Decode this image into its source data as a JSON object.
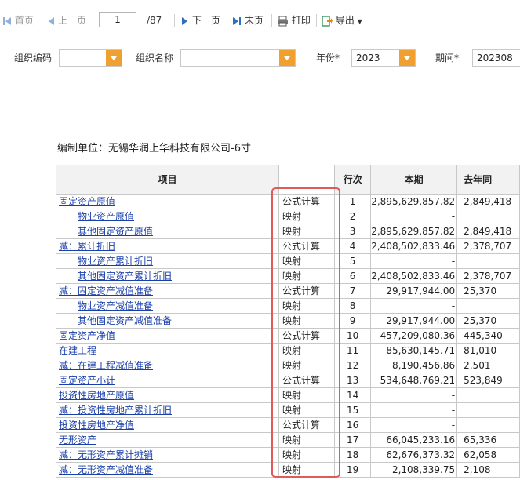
{
  "toolbar": {
    "first": "首页",
    "prev": "上一页",
    "page": "1",
    "total": "/87",
    "next": "下一页",
    "last": "末页",
    "print": "打印",
    "export": "导出"
  },
  "filters": {
    "org_code_label": "组织编码",
    "org_code_value": "",
    "org_name_label": "组织名称",
    "org_name_value": "",
    "year_label": "年份*",
    "year_value": "2023",
    "period_label": "期间*",
    "period_value": "202308"
  },
  "report": {
    "unit": "编制单位：无锡华润上华科技有限公司-6寸",
    "headers": {
      "item": "项目",
      "line": "行次",
      "current": "本期",
      "prev_year": "去年同"
    },
    "rows": [
      {
        "item": "固定资产原值",
        "type": "公式计算",
        "line": "1",
        "current": "2,895,629,857.82",
        "prev": "2,849,418"
      },
      {
        "item": "物业资产原值",
        "type": "映射",
        "line": "2",
        "current": "-",
        "prev": ""
      },
      {
        "item": "其他固定资产原值",
        "type": "映射",
        "line": "3",
        "current": "2,895,629,857.82",
        "prev": "2,849,418"
      },
      {
        "item": "减：累计折旧",
        "type": "公式计算",
        "line": "4",
        "current": "2,408,502,833.46",
        "prev": "2,378,707"
      },
      {
        "item": "物业资产累计折旧",
        "type": "映射",
        "line": "5",
        "current": "-",
        "prev": ""
      },
      {
        "item": "其他固定资产累计折旧",
        "type": "映射",
        "line": "6",
        "current": "2,408,502,833.46",
        "prev": "2,378,707"
      },
      {
        "item": "减：固定资产减值准备",
        "type": "公式计算",
        "line": "7",
        "current": "29,917,944.00",
        "prev": "25,370"
      },
      {
        "item": "物业资产减值准备",
        "type": "映射",
        "line": "8",
        "current": "-",
        "prev": ""
      },
      {
        "item": "其他固定资产减值准备",
        "type": "映射",
        "line": "9",
        "current": "29,917,944.00",
        "prev": "25,370"
      },
      {
        "item": "固定资产净值",
        "type": "公式计算",
        "line": "10",
        "current": "457,209,080.36",
        "prev": "445,340"
      },
      {
        "item": "在建工程",
        "type": "映射",
        "line": "11",
        "current": "85,630,145.71",
        "prev": "81,010"
      },
      {
        "item": "减：在建工程减值准备",
        "type": "映射",
        "line": "12",
        "current": "8,190,456.86",
        "prev": "2,501"
      },
      {
        "item": "固定资产小计",
        "type": "公式计算",
        "line": "13",
        "current": "534,648,769.21",
        "prev": "523,849"
      },
      {
        "item": "投资性房地产原值",
        "type": "映射",
        "line": "14",
        "current": "-",
        "prev": ""
      },
      {
        "item": "减：投资性房地产累计折旧",
        "type": "映射",
        "line": "15",
        "current": "-",
        "prev": ""
      },
      {
        "item": "投资性房地产净值",
        "type": "公式计算",
        "line": "16",
        "current": "-",
        "prev": ""
      },
      {
        "item": "无形资产",
        "type": "映射",
        "line": "17",
        "current": "66,045,233.16",
        "prev": "65,336"
      },
      {
        "item": "减：无形资产累计摊销",
        "type": "映射",
        "line": "18",
        "current": "62,676,373.32",
        "prev": "62,058"
      },
      {
        "item": "减：无形资产减值准备",
        "type": "映射",
        "line": "19",
        "current": "2,108,339.75",
        "prev": "2,108"
      }
    ],
    "indented_rows": [
      1,
      2,
      4,
      5,
      7,
      8
    ],
    "highlight_color": "#e05a5a",
    "accent_color": "#f0a030"
  }
}
